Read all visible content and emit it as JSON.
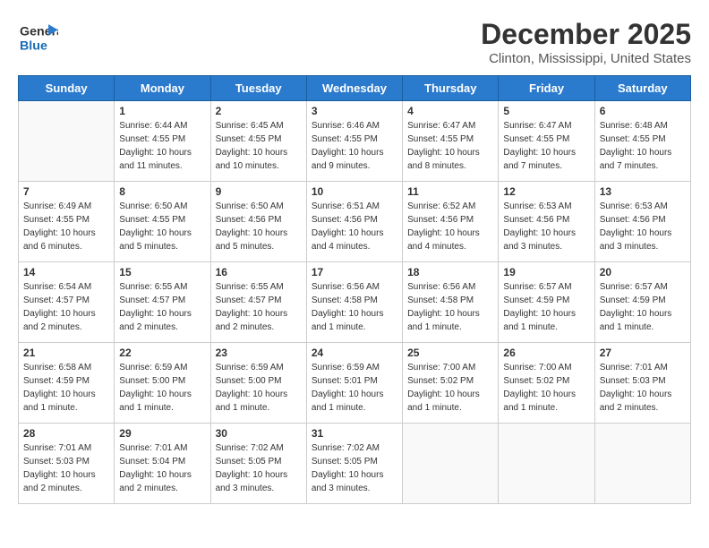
{
  "header": {
    "logo_general": "General",
    "logo_blue": "Blue",
    "title": "December 2025",
    "subtitle": "Clinton, Mississippi, United States"
  },
  "calendar": {
    "days_of_week": [
      "Sunday",
      "Monday",
      "Tuesday",
      "Wednesday",
      "Thursday",
      "Friday",
      "Saturday"
    ],
    "weeks": [
      [
        {
          "day": "",
          "sunrise": "",
          "sunset": "",
          "daylight": ""
        },
        {
          "day": "1",
          "sunrise": "Sunrise: 6:44 AM",
          "sunset": "Sunset: 4:55 PM",
          "daylight": "Daylight: 10 hours and 11 minutes."
        },
        {
          "day": "2",
          "sunrise": "Sunrise: 6:45 AM",
          "sunset": "Sunset: 4:55 PM",
          "daylight": "Daylight: 10 hours and 10 minutes."
        },
        {
          "day": "3",
          "sunrise": "Sunrise: 6:46 AM",
          "sunset": "Sunset: 4:55 PM",
          "daylight": "Daylight: 10 hours and 9 minutes."
        },
        {
          "day": "4",
          "sunrise": "Sunrise: 6:47 AM",
          "sunset": "Sunset: 4:55 PM",
          "daylight": "Daylight: 10 hours and 8 minutes."
        },
        {
          "day": "5",
          "sunrise": "Sunrise: 6:47 AM",
          "sunset": "Sunset: 4:55 PM",
          "daylight": "Daylight: 10 hours and 7 minutes."
        },
        {
          "day": "6",
          "sunrise": "Sunrise: 6:48 AM",
          "sunset": "Sunset: 4:55 PM",
          "daylight": "Daylight: 10 hours and 7 minutes."
        }
      ],
      [
        {
          "day": "7",
          "sunrise": "Sunrise: 6:49 AM",
          "sunset": "Sunset: 4:55 PM",
          "daylight": "Daylight: 10 hours and 6 minutes."
        },
        {
          "day": "8",
          "sunrise": "Sunrise: 6:50 AM",
          "sunset": "Sunset: 4:55 PM",
          "daylight": "Daylight: 10 hours and 5 minutes."
        },
        {
          "day": "9",
          "sunrise": "Sunrise: 6:50 AM",
          "sunset": "Sunset: 4:56 PM",
          "daylight": "Daylight: 10 hours and 5 minutes."
        },
        {
          "day": "10",
          "sunrise": "Sunrise: 6:51 AM",
          "sunset": "Sunset: 4:56 PM",
          "daylight": "Daylight: 10 hours and 4 minutes."
        },
        {
          "day": "11",
          "sunrise": "Sunrise: 6:52 AM",
          "sunset": "Sunset: 4:56 PM",
          "daylight": "Daylight: 10 hours and 4 minutes."
        },
        {
          "day": "12",
          "sunrise": "Sunrise: 6:53 AM",
          "sunset": "Sunset: 4:56 PM",
          "daylight": "Daylight: 10 hours and 3 minutes."
        },
        {
          "day": "13",
          "sunrise": "Sunrise: 6:53 AM",
          "sunset": "Sunset: 4:56 PM",
          "daylight": "Daylight: 10 hours and 3 minutes."
        }
      ],
      [
        {
          "day": "14",
          "sunrise": "Sunrise: 6:54 AM",
          "sunset": "Sunset: 4:57 PM",
          "daylight": "Daylight: 10 hours and 2 minutes."
        },
        {
          "day": "15",
          "sunrise": "Sunrise: 6:55 AM",
          "sunset": "Sunset: 4:57 PM",
          "daylight": "Daylight: 10 hours and 2 minutes."
        },
        {
          "day": "16",
          "sunrise": "Sunrise: 6:55 AM",
          "sunset": "Sunset: 4:57 PM",
          "daylight": "Daylight: 10 hours and 2 minutes."
        },
        {
          "day": "17",
          "sunrise": "Sunrise: 6:56 AM",
          "sunset": "Sunset: 4:58 PM",
          "daylight": "Daylight: 10 hours and 1 minute."
        },
        {
          "day": "18",
          "sunrise": "Sunrise: 6:56 AM",
          "sunset": "Sunset: 4:58 PM",
          "daylight": "Daylight: 10 hours and 1 minute."
        },
        {
          "day": "19",
          "sunrise": "Sunrise: 6:57 AM",
          "sunset": "Sunset: 4:59 PM",
          "daylight": "Daylight: 10 hours and 1 minute."
        },
        {
          "day": "20",
          "sunrise": "Sunrise: 6:57 AM",
          "sunset": "Sunset: 4:59 PM",
          "daylight": "Daylight: 10 hours and 1 minute."
        }
      ],
      [
        {
          "day": "21",
          "sunrise": "Sunrise: 6:58 AM",
          "sunset": "Sunset: 4:59 PM",
          "daylight": "Daylight: 10 hours and 1 minute."
        },
        {
          "day": "22",
          "sunrise": "Sunrise: 6:59 AM",
          "sunset": "Sunset: 5:00 PM",
          "daylight": "Daylight: 10 hours and 1 minute."
        },
        {
          "day": "23",
          "sunrise": "Sunrise: 6:59 AM",
          "sunset": "Sunset: 5:00 PM",
          "daylight": "Daylight: 10 hours and 1 minute."
        },
        {
          "day": "24",
          "sunrise": "Sunrise: 6:59 AM",
          "sunset": "Sunset: 5:01 PM",
          "daylight": "Daylight: 10 hours and 1 minute."
        },
        {
          "day": "25",
          "sunrise": "Sunrise: 7:00 AM",
          "sunset": "Sunset: 5:02 PM",
          "daylight": "Daylight: 10 hours and 1 minute."
        },
        {
          "day": "26",
          "sunrise": "Sunrise: 7:00 AM",
          "sunset": "Sunset: 5:02 PM",
          "daylight": "Daylight: 10 hours and 1 minute."
        },
        {
          "day": "27",
          "sunrise": "Sunrise: 7:01 AM",
          "sunset": "Sunset: 5:03 PM",
          "daylight": "Daylight: 10 hours and 2 minutes."
        }
      ],
      [
        {
          "day": "28",
          "sunrise": "Sunrise: 7:01 AM",
          "sunset": "Sunset: 5:03 PM",
          "daylight": "Daylight: 10 hours and 2 minutes."
        },
        {
          "day": "29",
          "sunrise": "Sunrise: 7:01 AM",
          "sunset": "Sunset: 5:04 PM",
          "daylight": "Daylight: 10 hours and 2 minutes."
        },
        {
          "day": "30",
          "sunrise": "Sunrise: 7:02 AM",
          "sunset": "Sunset: 5:05 PM",
          "daylight": "Daylight: 10 hours and 3 minutes."
        },
        {
          "day": "31",
          "sunrise": "Sunrise: 7:02 AM",
          "sunset": "Sunset: 5:05 PM",
          "daylight": "Daylight: 10 hours and 3 minutes."
        },
        {
          "day": "",
          "sunrise": "",
          "sunset": "",
          "daylight": ""
        },
        {
          "day": "",
          "sunrise": "",
          "sunset": "",
          "daylight": ""
        },
        {
          "day": "",
          "sunrise": "",
          "sunset": "",
          "daylight": ""
        }
      ]
    ]
  }
}
